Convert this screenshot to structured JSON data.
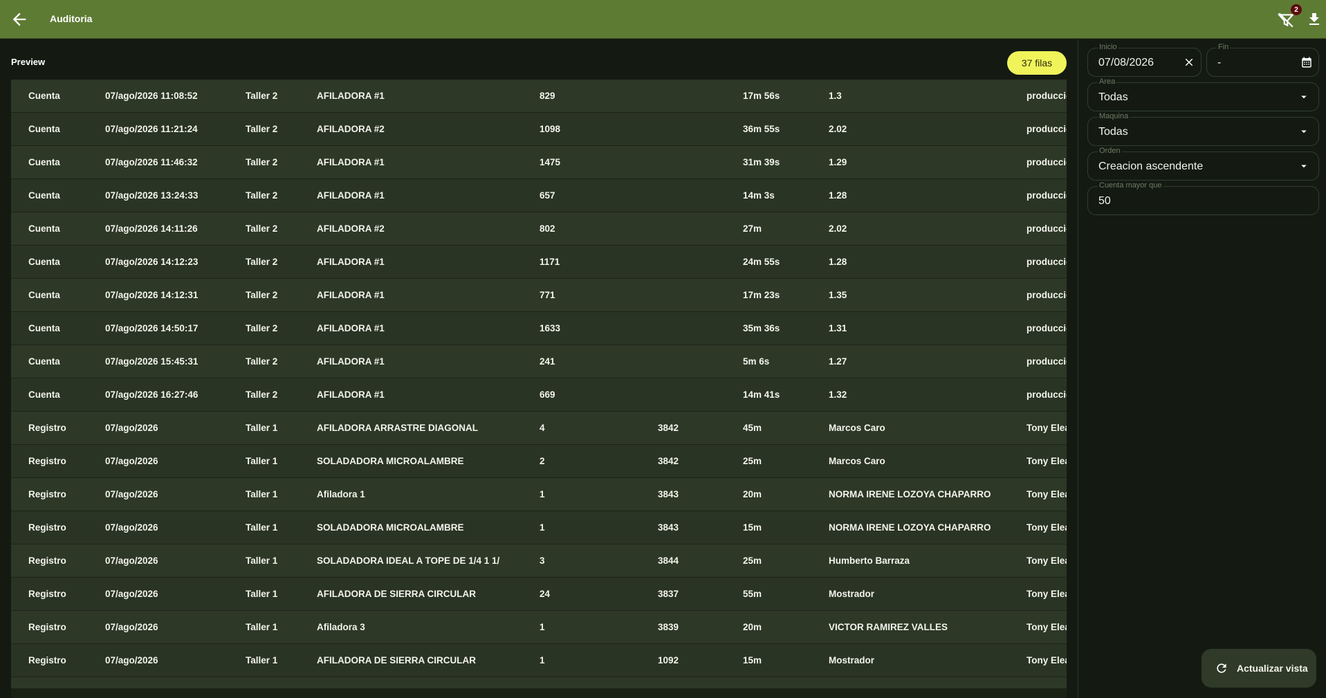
{
  "header": {
    "title": "Auditoria",
    "filter_badge": "2"
  },
  "preview": {
    "label": "Preview",
    "row_count": "37 filas"
  },
  "table": {
    "rows": [
      [
        "Cuenta",
        "07/ago/2026 11:08:52",
        "Taller 2",
        "AFILADORA #1",
        "829",
        "",
        "17m 56s",
        "1.3",
        "producción"
      ],
      [
        "Cuenta",
        "07/ago/2026 11:21:24",
        "Taller 2",
        "AFILADORA #2",
        "1098",
        "",
        "36m 55s",
        "2.02",
        "producción"
      ],
      [
        "Cuenta",
        "07/ago/2026 11:46:32",
        "Taller 2",
        "AFILADORA #1",
        "1475",
        "",
        "31m 39s",
        "1.29",
        "producción"
      ],
      [
        "Cuenta",
        "07/ago/2026 13:24:33",
        "Taller 2",
        "AFILADORA #1",
        "657",
        "",
        "14m 3s",
        "1.28",
        "producción"
      ],
      [
        "Cuenta",
        "07/ago/2026 14:11:26",
        "Taller 2",
        "AFILADORA #2",
        "802",
        "",
        "27m",
        "2.02",
        "producción"
      ],
      [
        "Cuenta",
        "07/ago/2026 14:12:23",
        "Taller 2",
        "AFILADORA #1",
        "1171",
        "",
        "24m 55s",
        "1.28",
        "producción"
      ],
      [
        "Cuenta",
        "07/ago/2026 14:12:31",
        "Taller 2",
        "AFILADORA #1",
        "771",
        "",
        "17m 23s",
        "1.35",
        "producción"
      ],
      [
        "Cuenta",
        "07/ago/2026 14:50:17",
        "Taller 2",
        "AFILADORA #1",
        "1633",
        "",
        "35m 36s",
        "1.31",
        "producción"
      ],
      [
        "Cuenta",
        "07/ago/2026 15:45:31",
        "Taller 2",
        "AFILADORA #1",
        "241",
        "",
        "5m 6s",
        "1.27",
        "producción"
      ],
      [
        "Cuenta",
        "07/ago/2026 16:27:46",
        "Taller 2",
        "AFILADORA #1",
        "669",
        "",
        "14m 41s",
        "1.32",
        "producción"
      ],
      [
        "Registro",
        "07/ago/2026",
        "Taller 1",
        "AFILADORA ARRASTRE DIAGONAL",
        "4",
        "3842",
        "45m",
        "Marcos Caro",
        "Tony Elea"
      ],
      [
        "Registro",
        "07/ago/2026",
        "Taller 1",
        "SOLADADORA MICROALAMBRE",
        "2",
        "3842",
        "25m",
        "Marcos Caro",
        "Tony Elea"
      ],
      [
        "Registro",
        "07/ago/2026",
        "Taller 1",
        "Afiladora 1",
        "1",
        "3843",
        "20m",
        "NORMA IRENE LOZOYA CHAPARRO",
        "Tony Elea"
      ],
      [
        "Registro",
        "07/ago/2026",
        "Taller 1",
        "SOLADADORA MICROALAMBRE",
        "1",
        "3843",
        "15m",
        "NORMA IRENE LOZOYA CHAPARRO",
        "Tony Elea"
      ],
      [
        "Registro",
        "07/ago/2026",
        "Taller 1",
        "SOLADADORA IDEAL A TOPE DE 1/4 1 1/",
        "3",
        "3844",
        "25m",
        "Humberto Barraza",
        "Tony Elea"
      ],
      [
        "Registro",
        "07/ago/2026",
        "Taller 1",
        "AFILADORA  DE SIERRA CIRCULAR",
        "24",
        "3837",
        "55m",
        "Mostrador",
        "Tony Elea"
      ],
      [
        "Registro",
        "07/ago/2026",
        "Taller 1",
        "Afiladora 3",
        "1",
        "3839",
        "20m",
        "VICTOR RAMIREZ VALLES",
        "Tony Elea"
      ],
      [
        "Registro",
        "07/ago/2026",
        "Taller 1",
        "AFILADORA  DE SIERRA CIRCULAR",
        "1",
        "1092",
        "15m",
        "Mostrador",
        "Tony Elea"
      ]
    ]
  },
  "filters": {
    "inicio": {
      "label": "Inicio",
      "value": "07/08/2026"
    },
    "fin": {
      "label": "Fin",
      "value": "-"
    },
    "area": {
      "label": "Area",
      "value": "Todas"
    },
    "maquina": {
      "label": "Maquina",
      "value": "Todas"
    },
    "orden": {
      "label": "Orden",
      "value": "Creacion ascendente"
    },
    "cuenta": {
      "label": "Cuenta mayor que",
      "value": "50"
    }
  },
  "actions": {
    "refresh_label": "Actualizar vista"
  }
}
